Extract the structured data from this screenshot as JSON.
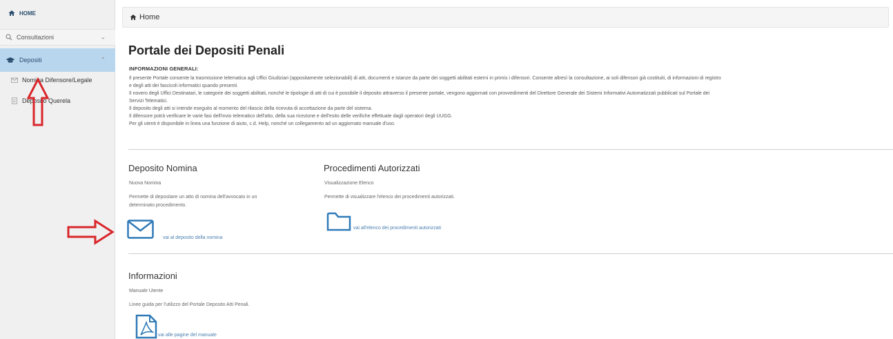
{
  "sidebar": {
    "home": "HOME",
    "consultazioni": "Consultazioni",
    "depositi": "Depositi",
    "nomina": "Nomina Difensore/Legale",
    "querela": "Deposito Querela"
  },
  "breadcrumb": {
    "label": "Home"
  },
  "page": {
    "title": "Portale dei Depositi Penali",
    "info_heading": "INFORMAZIONI GENERALI:",
    "info_lines": [
      "Il presente Portale consente la trasmissione telematica agli Uffici Giudiziari (appositamente selezionabili) di atti, documenti e istanze da parte dei soggetti abilitati esterni in primis i difensori. Consente altresì la consultazione, ai soli difensori già costituiti, di informazioni di registro",
      "e degli atti dei fascicoli informatici quando presenti.",
      "Il novero degli Uffici Destinatari, le categorie dei soggetti abilitati, nonché le tipologie di atti di cui è possibile il deposito attraverso il presente portale, vengono aggiornati con provvedimenti del Direttore Generale dei Sistemi Informativi Automatizzati pubblicati sul Portale dei",
      "Servizi Telematici.",
      "Il deposito degli atti si intende eseguito al momento del rilascio della ricevuta di accettazione da parte del sistema.",
      "Il difensore potrà verificare le varie fasi dell'invio telematico dell'atto, della sua ricezione e dell'esito delle verifiche effettuate dagli operatori degli UUGG.",
      "Per gli utenti è disponibile in linea una funzione di aiuto, c.d. Help, nonché un collegamento ad un aggiornato manuale d'uso."
    ]
  },
  "sections": {
    "nomina": {
      "title": "Deposito Nomina",
      "subtitle": "Nuova Nomina",
      "desc1": "Permette di depositare un atto di nomina dell'avvocato in un",
      "desc2": "determinato procedimento.",
      "link": "vai al deposito della nomina"
    },
    "procedimenti": {
      "title": "Procedimenti Autorizzati",
      "subtitle": "Visualizzazione Elenco",
      "desc": "Permette di visualizzare l'elenco dei procedimenti autorizzati.",
      "link": "vai all'elenco dei procedimenti autorizzati"
    },
    "informazioni": {
      "title": "Informazioni",
      "subtitle": "Manuale Utente",
      "desc": "Linee guida per l'utilizzo del Portale Deposito Atti Penali.",
      "link": "vai alle pagine del manuale"
    }
  },
  "colors": {
    "sidebar_bg": "#f0f0f0",
    "active_item_bg": "#b9d6ef",
    "accent_blue": "#2f7ab8",
    "annotation_red": "#d9262b"
  }
}
